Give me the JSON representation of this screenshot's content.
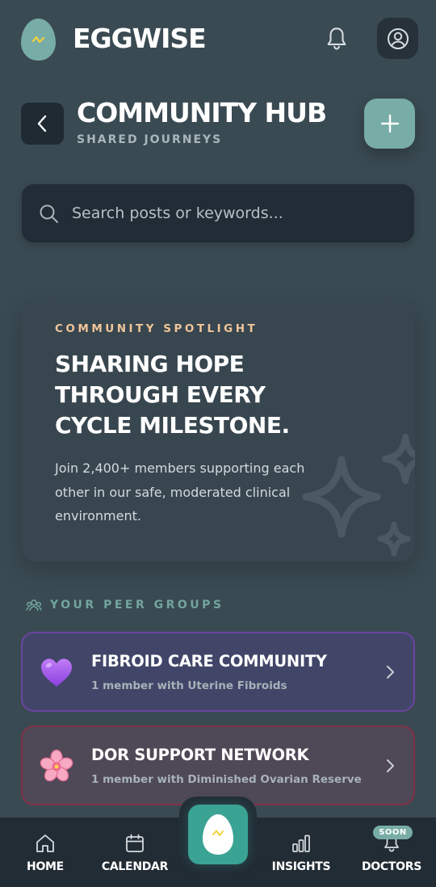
{
  "app": {
    "title": "EGGWISE",
    "brand_color": "#78aca6",
    "accent_color": "#3aa394"
  },
  "header": {
    "notification_icon": "bell-icon",
    "profile_icon": "user-circle-icon"
  },
  "page": {
    "title": "COMMUNITY HUB",
    "subtitle": "SHARED JOURNEYS",
    "back_icon": "chevron-left-icon",
    "add_icon": "plus-icon"
  },
  "search": {
    "placeholder": "Search posts or keywords...",
    "value": "",
    "icon": "search-icon"
  },
  "spotlight": {
    "label": "COMMUNITY SPOTLIGHT",
    "headline": "SHARING HOPE THROUGH EVERY CYCLE MILESTONE.",
    "body": "Join 2,400+ members supporting each other in our safe, moderated clinical environment.",
    "decor_icon": "sparkles-icon",
    "label_color": "#f0c59a"
  },
  "peer_groups": {
    "heading": "YOUR PEER GROUPS",
    "heading_icon": "users-icon",
    "groups": [
      {
        "emoji": "💜",
        "name": "FIBROID CARE COMMUNITY",
        "meta": "1 member with Uterine Fibroids",
        "border_color": "#6a449f"
      },
      {
        "emoji": "🌸",
        "name": "DOR SUPPORT NETWORK",
        "meta": "1 member with Diminished Ovarian Reserve",
        "border_color": "#7f3248"
      }
    ]
  },
  "bottom_nav": {
    "items": [
      {
        "label": "HOME",
        "icon": "home-icon"
      },
      {
        "label": "CALENDAR",
        "icon": "calendar-icon"
      },
      {
        "label": "INSIGHTS",
        "icon": "bar-chart-icon"
      },
      {
        "label": "DOCTORS",
        "icon": "bell-icon",
        "badge": "SOON"
      }
    ],
    "center_icon": "egg-icon"
  }
}
